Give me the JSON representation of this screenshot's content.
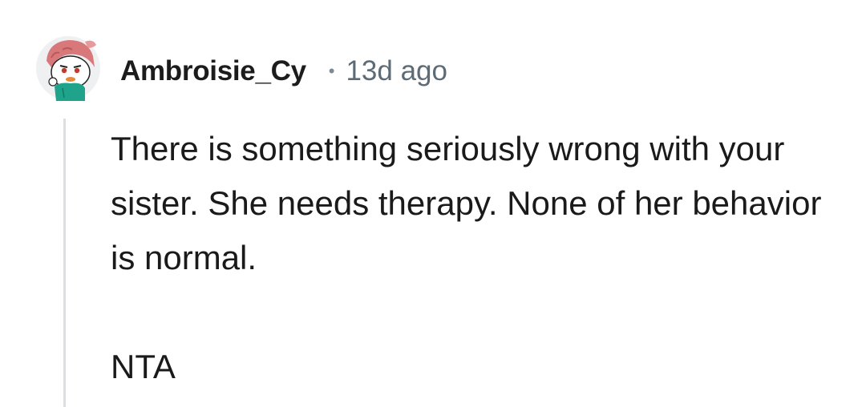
{
  "comment": {
    "author": "Ambroisie_Cy",
    "separator": "•",
    "timestamp": "13d ago",
    "avatar_icon": "snoo-avatar-icon",
    "paragraphs": [
      "There is something seriously wrong with your sister. She needs therapy. None of her behavior is normal.",
      "NTA"
    ]
  },
  "colors": {
    "author_text": "#1c1c1c",
    "meta_text": "#5c6b75",
    "body_text": "#1a1a1a",
    "thread_line": "#dcdfe2",
    "background": "#ffffff"
  }
}
